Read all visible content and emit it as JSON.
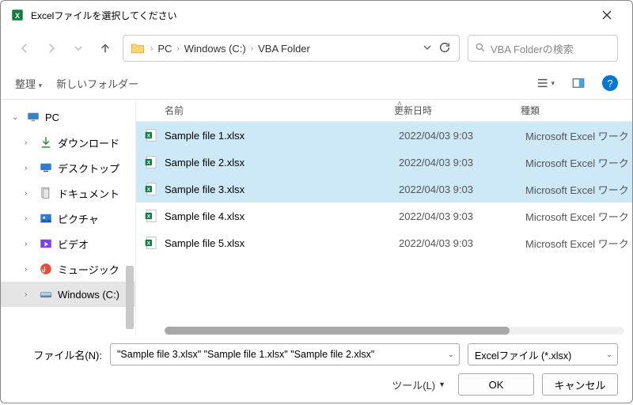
{
  "titlebar": {
    "title": "Excelファイルを選択してください"
  },
  "breadcrumb": {
    "pc": "PC",
    "drive": "Windows (C:)",
    "folder": "VBA Folder"
  },
  "search": {
    "placeholder": "VBA Folderの検索"
  },
  "toolbar": {
    "organize": "整理",
    "newfolder": "新しいフォルダー"
  },
  "columns": {
    "name": "名前",
    "date": "更新日時",
    "type": "種類"
  },
  "tree": {
    "pc": "PC",
    "downloads": "ダウンロード",
    "desktop": "デスクトップ",
    "documents": "ドキュメント",
    "pictures": "ピクチャ",
    "videos": "ビデオ",
    "music": "ミュージック",
    "drive": "Windows (C:)"
  },
  "files": [
    {
      "name": "Sample file 1.xlsx",
      "date": "2022/04/03 9:03",
      "type": "Microsoft Excel ワーク",
      "selected": true
    },
    {
      "name": "Sample file 2.xlsx",
      "date": "2022/04/03 9:03",
      "type": "Microsoft Excel ワーク",
      "selected": true
    },
    {
      "name": "Sample file 3.xlsx",
      "date": "2022/04/03 9:03",
      "type": "Microsoft Excel ワーク",
      "selected": true
    },
    {
      "name": "Sample file 4.xlsx",
      "date": "2022/04/03 9:03",
      "type": "Microsoft Excel ワーク",
      "selected": false
    },
    {
      "name": "Sample file 5.xlsx",
      "date": "2022/04/03 9:03",
      "type": "Microsoft Excel ワーク",
      "selected": false
    }
  ],
  "filename": {
    "label": "ファイル名(N):",
    "value": "\"Sample file 3.xlsx\" \"Sample file 1.xlsx\" \"Sample file 2.xlsx\"",
    "filter": "Excelファイル (*.xlsx)"
  },
  "buttons": {
    "tools": "ツール(L)",
    "ok": "OK",
    "cancel": "キャンセル"
  }
}
